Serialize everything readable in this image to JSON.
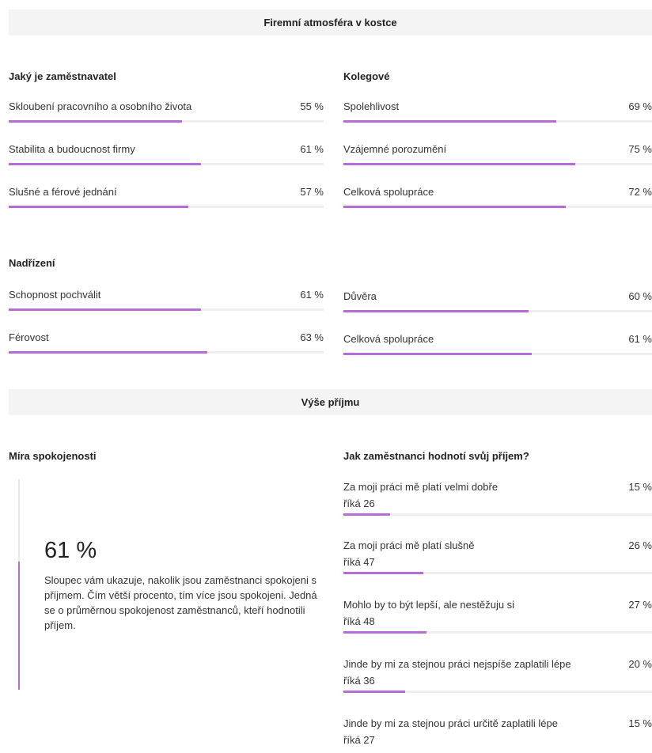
{
  "atmosphere": {
    "header": "Firemní atmosféra v kostce",
    "employer": {
      "title": "Jaký je zaměstnavatel",
      "items": [
        {
          "label": "Skloubení pracovního a osobního života",
          "value": "55 %",
          "pct": 55
        },
        {
          "label": "Stabilita a budoucnost firmy",
          "value": "61 %",
          "pct": 61
        },
        {
          "label": "Slušné a férové jednání",
          "value": "57 %",
          "pct": 57
        }
      ]
    },
    "colleagues": {
      "title": "Kolegové",
      "items": [
        {
          "label": "Spolehlivost",
          "value": "69 %",
          "pct": 69
        },
        {
          "label": "Vzájemné porozumění",
          "value": "75 %",
          "pct": 75
        },
        {
          "label": "Celková spolupráce",
          "value": "72 %",
          "pct": 72
        }
      ]
    },
    "supervisors": {
      "title": "Nadřízení",
      "left": [
        {
          "label": "Schopnost pochválit",
          "value": "61 %",
          "pct": 61
        },
        {
          "label": "Férovost",
          "value": "63 %",
          "pct": 63
        }
      ],
      "right": [
        {
          "label": "Důvěra",
          "value": "60 %",
          "pct": 60
        },
        {
          "label": "Celková spolupráce",
          "value": "61 %",
          "pct": 61
        }
      ]
    }
  },
  "income": {
    "header": "Výše příjmu",
    "satisfaction": {
      "title": "Míra spokojenosti",
      "percent": "61 %",
      "pct": 61,
      "description": "Sloupec vám ukazuje, nakolik jsou zaměstnanci spokojeni s příjmem. Čím větší procento, tím více jsou spokojeni. Jedná se o průměrnou spokojenost zaměstnanců, kteří hodnotili příjem."
    },
    "ratings": {
      "title": "Jak zaměstnanci hodnotí svůj příjem?",
      "items": [
        {
          "label": "Za moji práci mě platí velmi dobře",
          "sub": "říká 26",
          "value": "15 %",
          "pct": 15
        },
        {
          "label": "Za moji práci mě platí slušně",
          "sub": "říká 47",
          "value": "26 %",
          "pct": 26
        },
        {
          "label": "Mohlo by to být lepší, ale nestěžuju si",
          "sub": "říká 48",
          "value": "27 %",
          "pct": 27
        },
        {
          "label": "Jinde by mi za stejnou práci nejspíše zaplatili lépe",
          "sub": "říká 36",
          "value": "20 %",
          "pct": 20
        },
        {
          "label": "Jinde by mi za stejnou práci určitě zaplatili lépe",
          "sub": "říká 27",
          "value": "15 %",
          "pct": 15
        }
      ]
    }
  },
  "colors": {
    "accent": "#b76bd6",
    "track": "#eeeeee",
    "header_bg": "#f4f4f4"
  }
}
